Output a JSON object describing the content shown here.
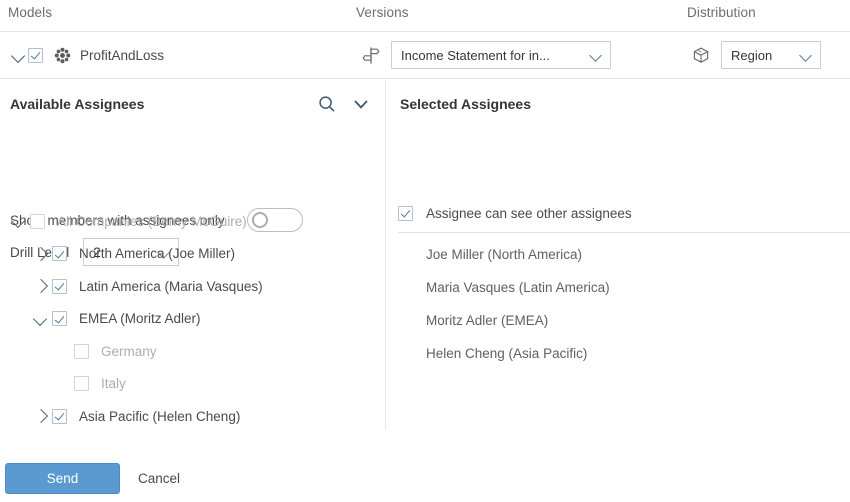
{
  "columns": {
    "models_label": "Models",
    "versions_label": "Versions",
    "distribution_label": "Distribution"
  },
  "toolbar": {
    "model": {
      "expand_icon": "chevron-down-icon",
      "checkbox_checked": true,
      "icon": "model-icon",
      "name": "ProfitAndLoss"
    },
    "version": {
      "icon": "signpost-icon",
      "selected": "Income Statement for in...",
      "caret_icon": "chevron-down-icon"
    },
    "distribution": {
      "icon": "cube-icon",
      "selected": "Region",
      "caret_icon": "chevron-down-icon"
    }
  },
  "left_panel": {
    "title": "Available Assignees",
    "search_icon": "search-icon",
    "collapse_icon": "chevron-down-icon",
    "show_members_label": "Show members with assignees only",
    "show_members_toggle_on": false,
    "drill_level_label": "Drill Level",
    "drill_level_value": "2",
    "tree": [
      {
        "label": "All Companies (Berny McGuire)",
        "indent": 0,
        "twisty": "down",
        "checked": false,
        "disabled": true,
        "has_checkbox": true
      },
      {
        "label": "North America (Joe Miller)",
        "indent": 1,
        "twisty": "right",
        "checked": true,
        "disabled": false,
        "has_checkbox": true
      },
      {
        "label": "Latin America (Maria Vasques)",
        "indent": 1,
        "twisty": "right",
        "checked": true,
        "disabled": false,
        "has_checkbox": true
      },
      {
        "label": "EMEA (Moritz Adler)",
        "indent": 1,
        "twisty": "down",
        "checked": true,
        "disabled": false,
        "has_checkbox": true
      },
      {
        "label": "Germany",
        "indent": 2,
        "twisty": "none",
        "checked": false,
        "disabled": true,
        "has_checkbox": true
      },
      {
        "label": "Italy",
        "indent": 2,
        "twisty": "none",
        "checked": false,
        "disabled": true,
        "has_checkbox": true
      },
      {
        "label": "Asia Pacific (Helen Cheng)",
        "indent": 1,
        "twisty": "right",
        "checked": true,
        "disabled": false,
        "has_checkbox": true
      }
    ]
  },
  "right_panel": {
    "title": "Selected Assignees",
    "see_others_label": "Assignee can see other assignees",
    "see_others_checked": true,
    "assignees": [
      "Joe Miller (North America)",
      "Maria Vasques (Latin America)",
      "Moritz Adler (EMEA)",
      "Helen Cheng (Asia Pacific)"
    ]
  },
  "footer": {
    "send_label": "Send",
    "cancel_label": "Cancel"
  },
  "colors": {
    "accent_blue": "#5a9ad1",
    "check_blue": "#4a7ba8",
    "text": "#4a4a4a",
    "muted": "#a8aeb3",
    "border": "#e5e5e5"
  }
}
